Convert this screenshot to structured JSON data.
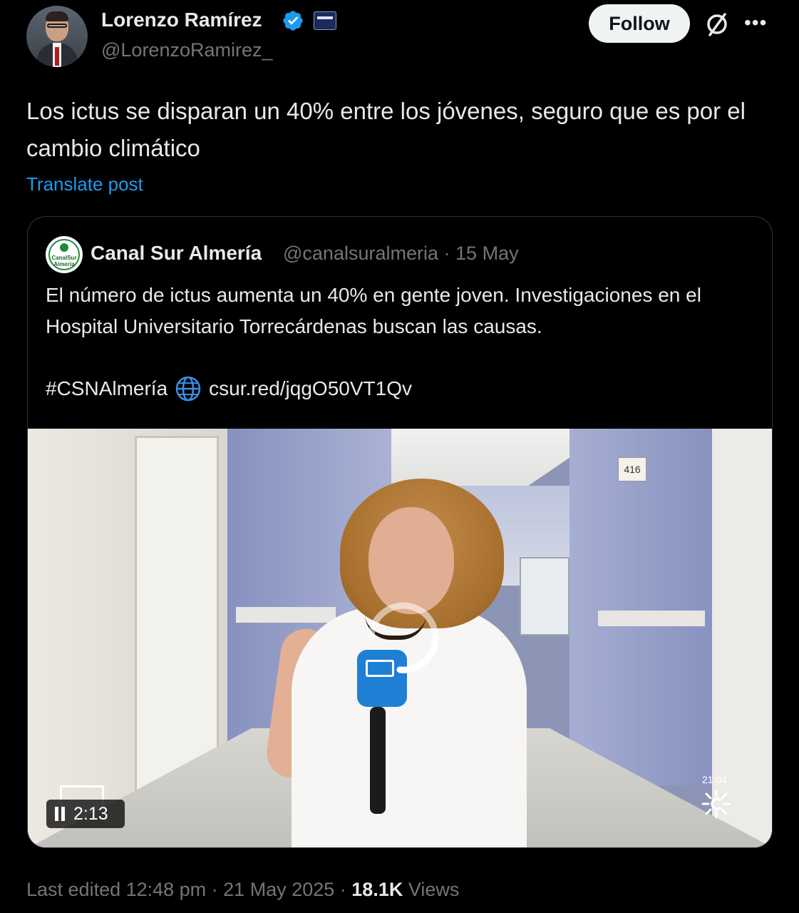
{
  "author": {
    "display_name": "Lorenzo Ramírez",
    "handle": "@LorenzoRamirez_"
  },
  "actions": {
    "follow_label": "Follow"
  },
  "post": {
    "text": "Los ictus se disparan un 40% entre los jóvenes, seguro que es por el cambio climático",
    "translate_label": "Translate post"
  },
  "quoted": {
    "name": "Canal Sur Almería",
    "handle": "@canalsuralmeria",
    "separator": "·",
    "date": "15 May",
    "text": "El número de ictus aumenta un 40% en gente joven. Investigaciones en el Hospital Universitario Torrecárdenas buscan las causas.",
    "hashtag": "#CSNAlmería",
    "link": "csur.red/jqgO50VT1Qv",
    "media": {
      "duration": "2:13",
      "clock": "21:04",
      "room_sign": "416"
    }
  },
  "footer": {
    "edited": "Last edited 12:48 pm · 21 May 2025 · ",
    "views_count": "18.1K",
    "views_label": " Views"
  },
  "colors": {
    "background": "#000000",
    "text": "#e7e9ea",
    "muted": "#71767b",
    "link": "#1d9bf0",
    "verified": "#1d9bf0"
  }
}
